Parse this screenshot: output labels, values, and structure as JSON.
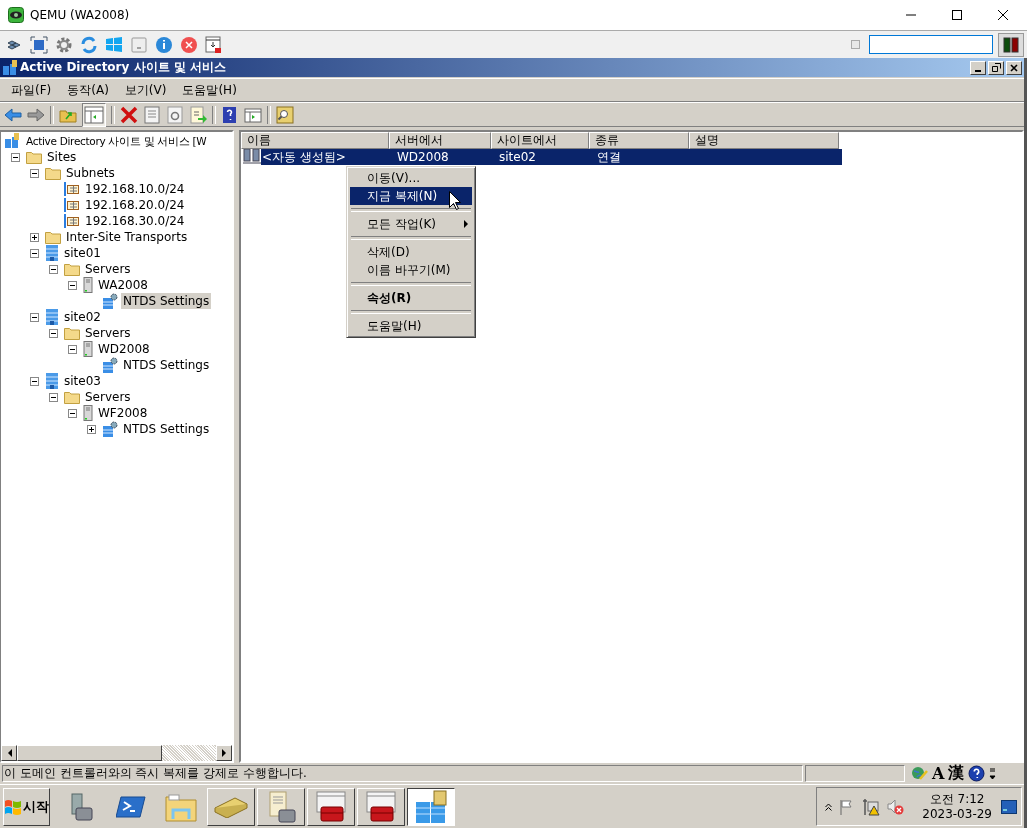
{
  "window": {
    "title": "QEMU (WA2008)"
  },
  "mmc": {
    "title": "Active Directory 사이트 및 서비스"
  },
  "menu": [
    "파일(F)",
    "동작(A)",
    "보기(V)",
    "도움말(H)"
  ],
  "tree": {
    "root": "Active Directory 사이트 및 서비스 [W",
    "items": [
      {
        "label": "Sites",
        "kind": "folder",
        "expanded": true,
        "selected": false,
        "children": [
          {
            "label": "Subnets",
            "kind": "folder",
            "expanded": true,
            "selected": false,
            "children": [
              {
                "label": "192.168.10.0/24",
                "kind": "subnet",
                "selected": false
              },
              {
                "label": "192.168.20.0/24",
                "kind": "subnet",
                "selected": false
              },
              {
                "label": "192.168.30.0/24",
                "kind": "subnet",
                "selected": false
              }
            ]
          },
          {
            "label": "Inter-Site Transports",
            "kind": "folder",
            "expanded": false,
            "selected": false
          },
          {
            "label": "site01",
            "kind": "site",
            "expanded": true,
            "selected": false,
            "children": [
              {
                "label": "Servers",
                "kind": "folder",
                "expanded": true,
                "selected": false,
                "children": [
                  {
                    "label": "WA2008",
                    "kind": "server",
                    "expanded": true,
                    "selected": false,
                    "children": [
                      {
                        "label": "NTDS Settings",
                        "kind": "ntds",
                        "selected": true
                      }
                    ]
                  }
                ]
              }
            ]
          },
          {
            "label": "site02",
            "kind": "site",
            "expanded": true,
            "selected": false,
            "children": [
              {
                "label": "Servers",
                "kind": "folder",
                "expanded": true,
                "selected": false,
                "children": [
                  {
                    "label": "WD2008",
                    "kind": "server",
                    "expanded": true,
                    "selected": false,
                    "children": [
                      {
                        "label": "NTDS Settings",
                        "kind": "ntds",
                        "selected": false
                      }
                    ]
                  }
                ]
              }
            ]
          },
          {
            "label": "site03",
            "kind": "site",
            "expanded": true,
            "selected": false,
            "children": [
              {
                "label": "Servers",
                "kind": "folder",
                "expanded": true,
                "selected": false,
                "children": [
                  {
                    "label": "WF2008",
                    "kind": "server",
                    "expanded": true,
                    "selected": false,
                    "children": [
                      {
                        "label": "NTDS Settings",
                        "kind": "ntds",
                        "expanded": false,
                        "selected": false
                      }
                    ]
                  }
                ]
              }
            ]
          }
        ]
      }
    ]
  },
  "list": {
    "columns": [
      "이름",
      "서버에서",
      "사이트에서",
      "종류",
      "설명"
    ],
    "rows": [
      {
        "name": "<자동 생성됨>",
        "from_server": "WD2008",
        "from_site": "site02",
        "type": "연결",
        "selected": true
      }
    ]
  },
  "context_menu": [
    {
      "kind": "item",
      "label": "이동(V)...",
      "selected": false,
      "default": false
    },
    {
      "kind": "item",
      "label": "지금 복제(N)",
      "selected": true,
      "default": false
    },
    {
      "kind": "separator"
    },
    {
      "kind": "submenu",
      "label": "모든 작업(K)",
      "selected": false,
      "default": false
    },
    {
      "kind": "separator"
    },
    {
      "kind": "item",
      "label": "삭제(D)",
      "selected": false,
      "default": false
    },
    {
      "kind": "item",
      "label": "이름 바꾸기(M)",
      "selected": false,
      "default": false
    },
    {
      "kind": "separator"
    },
    {
      "kind": "item",
      "label": "속성(R)",
      "selected": false,
      "default": true
    },
    {
      "kind": "separator"
    },
    {
      "kind": "item",
      "label": "도움말(H)",
      "selected": false,
      "default": false
    }
  ],
  "status_bar": {
    "text": "이 도메인 컨트롤러와의 즉시 복제를 강제로 수행합니다.",
    "ime": [
      "A",
      "漢"
    ]
  },
  "taskbar": {
    "start": "시작",
    "buttons": [
      {
        "selected": false
      },
      {
        "selected": false
      },
      {
        "selected": false
      },
      {
        "selected": false
      },
      {
        "selected": false
      },
      {
        "selected": false
      },
      {
        "selected": false
      },
      {
        "selected": true
      }
    ],
    "clock": {
      "time": "오전 7:12",
      "date": "2023-03-29"
    }
  }
}
